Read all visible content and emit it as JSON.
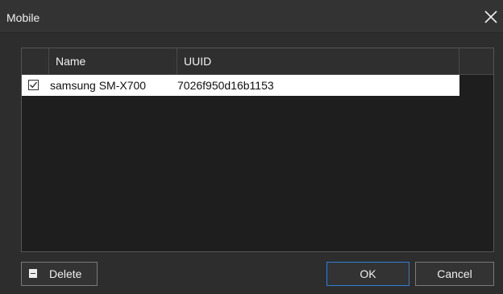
{
  "window": {
    "title": "Mobile",
    "close_icon": "close-icon"
  },
  "table": {
    "columns": [
      "Name",
      "UUID"
    ],
    "rows": [
      {
        "checked": true,
        "name": "samsung SM-X700",
        "uuid": "7026f950d16b1153"
      }
    ]
  },
  "buttons": {
    "delete_label": "Delete",
    "delete_icon": "delete-icon",
    "ok_label": "OK",
    "cancel_label": "Cancel"
  },
  "colors": {
    "background": "#2d2d2d",
    "row_selected": "#ffffff",
    "focus_border": "#2f7ed8"
  }
}
